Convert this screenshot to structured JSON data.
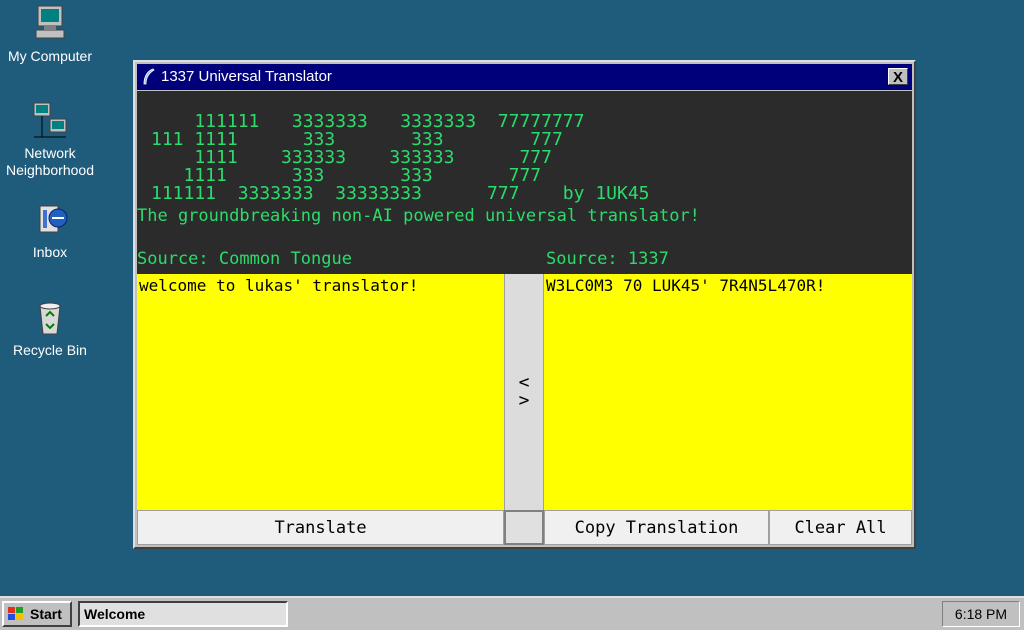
{
  "desktop": {
    "icons": [
      {
        "label": "My Computer",
        "icon": "computer-icon"
      },
      {
        "label": "Network\nNeighborhood",
        "icon": "network-icon"
      },
      {
        "label": "Inbox",
        "icon": "inbox-icon"
      },
      {
        "label": "Recycle Bin",
        "icon": "recycle-bin-icon"
      }
    ]
  },
  "window": {
    "title": "1337 Universal Translator",
    "close_label": "X",
    "icon": "quill-icon"
  },
  "app": {
    "ascii_art": "    111111   3333333   3333333  77777777\n111 1111      333       333        777\n    1111    333333    333333      777\n   1111      333       333       777\n111111  3333333  33333333      777    by 1UK45",
    "tagline": "The groundbreaking non-AI powered universal translator!",
    "source_left": "Source: Common Tongue",
    "source_right": "Source: 1337",
    "input_text": "welcome to lukas' translator!",
    "output_text": "W3LC0M3 70 LUK45' 7R4N5L470R!",
    "swap_label_top": "<",
    "swap_label_bottom": ">",
    "translate_label": "Translate",
    "copy_label": "Copy Translation",
    "clear_label": "Clear All"
  },
  "colors": {
    "desktop": "#1f5c7c",
    "app_bg": "#2b2b2b",
    "accent_green": "#2bdc6b",
    "pane_yellow": "#ffff00",
    "title_blue": "#00007b"
  },
  "taskbar": {
    "start_label": "Start",
    "task_label": "Welcome",
    "clock": "6:18 PM"
  }
}
